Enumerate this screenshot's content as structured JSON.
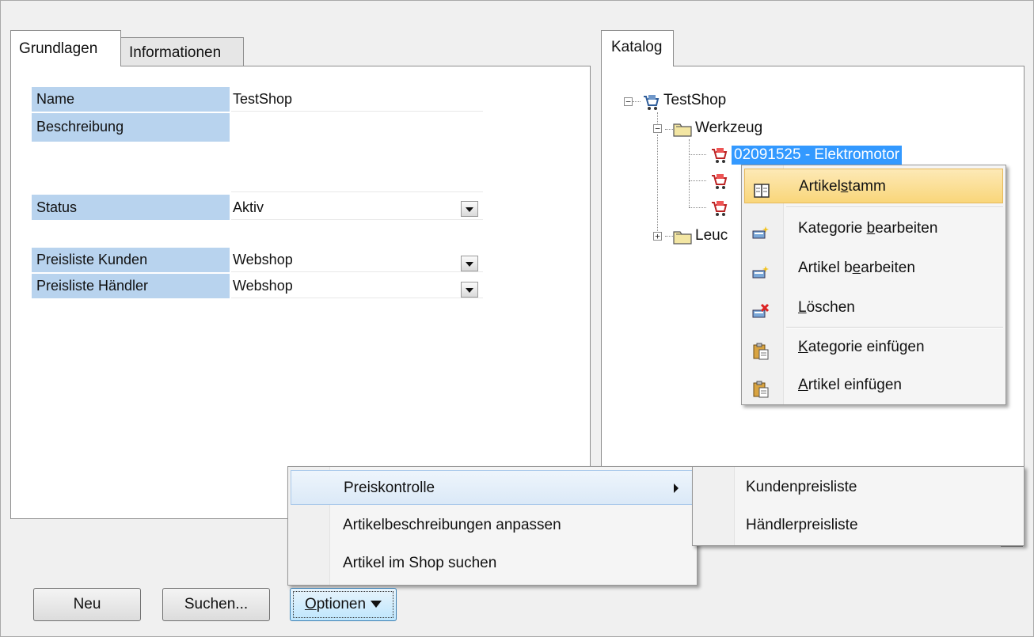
{
  "left_tabs": {
    "grundlagen": "Grundlagen",
    "informationen": "Informationen"
  },
  "form": {
    "name_label": "Name",
    "name_value": "TestShop",
    "beschreibung_label": "Beschreibung",
    "beschreibung_value": "",
    "status_label": "Status",
    "status_value": "Aktiv",
    "preis_kunden_label": "Preisliste Kunden",
    "preis_kunden_value": "Webshop",
    "preis_haendler_label": "Preisliste Händler",
    "preis_haendler_value": "Webshop"
  },
  "catalog": {
    "tab": "Katalog",
    "root": "TestShop",
    "category_1": "Werkzeug",
    "selected_item": "02091525 - Elektromotor",
    "category_2_partial": "Leuc",
    "partial_item_2": "",
    "partial_item_3": ""
  },
  "context_menu": {
    "items": [
      {
        "pre": "Artikel",
        "ul": "s",
        "post": "tamm",
        "icon": "book-icon"
      },
      {
        "pre": "Kategorie ",
        "ul": "b",
        "post": "earbeiten",
        "icon": "edit-category-icon"
      },
      {
        "pre": "Artikel b",
        "ul": "e",
        "post": "arbeiten",
        "icon": "edit-article-icon"
      },
      {
        "pre": "",
        "ul": "L",
        "post": "öschen",
        "icon": "delete-icon"
      },
      {
        "pre": "",
        "ul": "K",
        "post": "ategorie einfügen",
        "icon": "paste-icon"
      },
      {
        "pre": "",
        "ul": "A",
        "post": "rtikel einfügen",
        "icon": "paste-icon"
      }
    ]
  },
  "options_menu": {
    "preiskontrolle": "Preiskontrolle",
    "artikelbeschreibungen": "Artikelbeschreibungen anpassen",
    "artikel_suchen": "Artikel im Shop suchen"
  },
  "sub_menu": {
    "kunden": "Kundenpreisliste",
    "haendler": "Händlerpreisliste"
  },
  "buttons": {
    "neu": "Neu",
    "suchen": "Suchen...",
    "optionen_ul": "O",
    "optionen_rest": "ptionen"
  }
}
